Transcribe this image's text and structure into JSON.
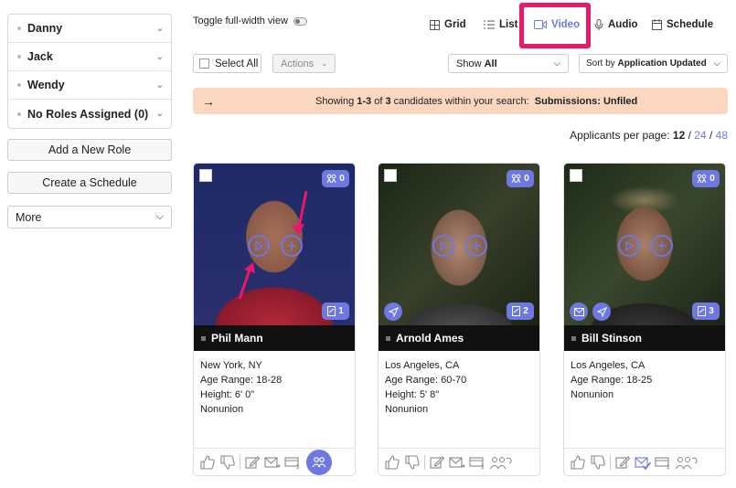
{
  "sidebar": {
    "roles": [
      {
        "label": "Danny"
      },
      {
        "label": "Jack"
      },
      {
        "label": "Wendy"
      },
      {
        "label": "No Roles Assigned (0)"
      }
    ],
    "add_role": "Add a New Role",
    "create_schedule": "Create a Schedule",
    "more": "More"
  },
  "toolbar": {
    "toggle_label": "Toggle full-width view",
    "views": {
      "grid": "Grid",
      "list": "List",
      "video": "Video",
      "audio": "Audio",
      "schedule": "Schedule"
    },
    "select_all": "Select All",
    "actions": "Actions",
    "show_prefix": "Show",
    "show_value": "All",
    "sort_prefix": "Sort by",
    "sort_value": "Application Updated"
  },
  "banner": {
    "pre": "Showing",
    "range": "1-3",
    "mid": "of",
    "total": "3",
    "post": "candidates within your search:",
    "filter": "Submissions: Unfiled"
  },
  "perpage": {
    "label": "Applicants per page:",
    "opt1": "12",
    "opt2": "24",
    "opt3": "48"
  },
  "colors": {
    "accent": "#6d78e0",
    "highlight": "#e8196b",
    "banner": "#fcd7c0"
  },
  "cards": [
    {
      "name": "Phil Mann",
      "location": "New York, NY",
      "age": "Age Range: 18-28",
      "height": "Height: 6' 0\"",
      "union": "Nonunion",
      "match_count": "0",
      "media_count": "1"
    },
    {
      "name": "Arnold Ames",
      "location": "Los Angeles, CA",
      "age": "Age Range: 60-70",
      "height": "Height: 5' 8\"",
      "union": "Nonunion",
      "match_count": "0",
      "media_count": "2"
    },
    {
      "name": "Bill Stinson",
      "location": "Los Angeles, CA",
      "age": "Age Range: 18-25",
      "height": "",
      "union": "Nonunion",
      "match_count": "0",
      "media_count": "3"
    }
  ]
}
